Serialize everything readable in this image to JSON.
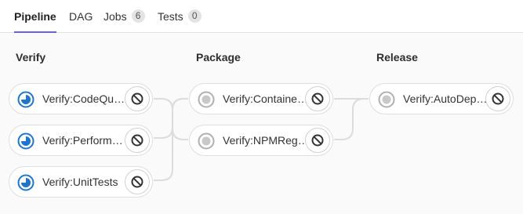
{
  "tabs": [
    {
      "label": "Pipeline",
      "active": true
    },
    {
      "label": "DAG"
    },
    {
      "label": "Jobs",
      "count": "6"
    },
    {
      "label": "Tests",
      "count": "0"
    }
  ],
  "stages": [
    {
      "title": "Verify",
      "jobs": [
        {
          "name": "Verify:CodeQuality",
          "status": "running-icon"
        },
        {
          "name": "Verify:Performance",
          "status": "running-icon"
        },
        {
          "name": "Verify:UnitTests",
          "status": "running-icon"
        }
      ]
    },
    {
      "title": "Package",
      "jobs": [
        {
          "name": "Verify:ContainerScanning",
          "status": "created-icon"
        },
        {
          "name": "Verify:NPMRegistry",
          "status": "created-icon"
        }
      ]
    },
    {
      "title": "Release",
      "jobs": [
        {
          "name": "Verify:AutoDeploy",
          "status": "created-icon"
        }
      ]
    }
  ],
  "colors": {
    "accent": "#6666c4",
    "running": "#1f75cb",
    "created": "#b0b0b0"
  },
  "action_icon": "cancel-icon"
}
